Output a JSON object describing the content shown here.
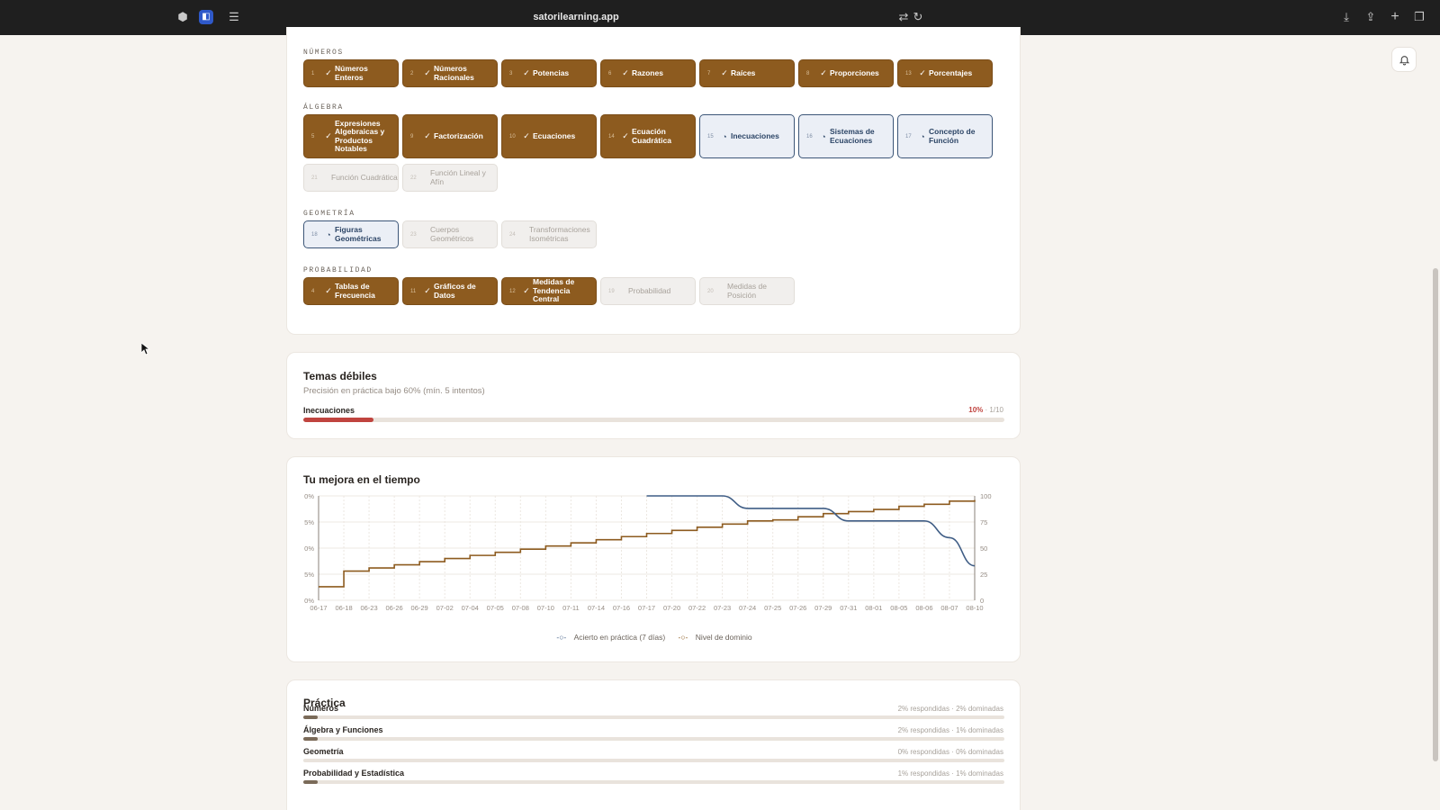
{
  "browser": {
    "url": "satorilearning.app",
    "icons": [
      "sidebar-icon",
      "shield-extension-icon",
      "tab-overview-icon",
      "translate-icon",
      "reload-icon",
      "download-icon",
      "share-icon",
      "new-tab-icon",
      "tabs-icon"
    ]
  },
  "curriculum": {
    "status_legend": {
      "done": "check-icon",
      "in_progress": "progress-clock-icon",
      "locked": "none"
    },
    "sections": [
      {
        "title": "NÚMEROS",
        "chips": [
          {
            "num": "1",
            "label": "Números Enteros",
            "status": "done"
          },
          {
            "num": "2",
            "label": "Números Racionales",
            "status": "done"
          },
          {
            "num": "3",
            "label": "Potencias",
            "status": "done"
          },
          {
            "num": "6",
            "label": "Razones",
            "status": "done"
          },
          {
            "num": "7",
            "label": "Raíces",
            "status": "done"
          },
          {
            "num": "8",
            "label": "Proporciones",
            "status": "done"
          },
          {
            "num": "13",
            "label": "Porcentajes",
            "status": "done"
          }
        ]
      },
      {
        "title": "ÁLGEBRA",
        "chips": [
          {
            "num": "5",
            "label": "Expresiones Algebraicas y Productos Notables",
            "status": "done"
          },
          {
            "num": "9",
            "label": "Factorización",
            "status": "done"
          },
          {
            "num": "10",
            "label": "Ecuaciones",
            "status": "done"
          },
          {
            "num": "14",
            "label": "Ecuación Cuadrática",
            "status": "done"
          },
          {
            "num": "15",
            "label": "Inecuaciones",
            "status": "in_progress"
          },
          {
            "num": "16",
            "label": "Sistemas de Ecuaciones",
            "status": "in_progress"
          },
          {
            "num": "17",
            "label": "Concepto de Función",
            "status": "in_progress"
          },
          {
            "num": "21",
            "label": "Función Cuadrática",
            "status": "locked"
          },
          {
            "num": "22",
            "label": "Función Lineal y Afín",
            "status": "locked"
          }
        ]
      },
      {
        "title": "GEOMETRÍA",
        "chips": [
          {
            "num": "18",
            "label": "Figuras Geométricas",
            "status": "in_progress"
          },
          {
            "num": "23",
            "label": "Cuerpos Geométricos",
            "status": "locked"
          },
          {
            "num": "24",
            "label": "Transformaciones Isométricas",
            "status": "locked"
          }
        ]
      },
      {
        "title": "PROBABILIDAD",
        "chips": [
          {
            "num": "4",
            "label": "Tablas de Frecuencia",
            "status": "done"
          },
          {
            "num": "11",
            "label": "Gráficos de Datos",
            "status": "done"
          },
          {
            "num": "12",
            "label": "Medidas de Tendencia Central",
            "status": "done"
          },
          {
            "num": "19",
            "label": "Probabilidad",
            "status": "locked"
          },
          {
            "num": "20",
            "label": "Medidas de Posición",
            "status": "locked"
          }
        ]
      }
    ]
  },
  "weak_topics": {
    "title": "Temas débiles",
    "subtitle": "Precisión en práctica bajo 60% (mín. 5 intentos)",
    "items": [
      {
        "label": "Inecuaciones",
        "pct_text": "10%",
        "count_text": "· 1/10",
        "fraction": 0.1
      }
    ]
  },
  "improvement": {
    "title": "Tu mejora en el tiempo"
  },
  "chart_data": {
    "type": "line",
    "title": "Tu mejora en el tiempo",
    "x": [
      "06-17",
      "06-18",
      "06-23",
      "06-26",
      "06-29",
      "07-02",
      "07-04",
      "07-05",
      "07-08",
      "07-10",
      "07-11",
      "07-14",
      "07-16",
      "07-17",
      "07-20",
      "07-22",
      "07-23",
      "07-24",
      "07-25",
      "07-26",
      "07-29",
      "07-31",
      "08-01",
      "08-05",
      "08-06",
      "08-07",
      "08-10"
    ],
    "y_left_ticks": [
      "0%",
      "5%",
      "0%",
      "5%",
      "0%"
    ],
    "y_right_ticks": [
      "100",
      "75",
      "50",
      "25",
      "0"
    ],
    "y_right_range": [
      0,
      100
    ],
    "grid": true,
    "legend_position": "bottom-center",
    "series": [
      {
        "name": "Acierto en práctica (7 días)",
        "color": "#3f5d85",
        "axis": "left",
        "values": [
          null,
          null,
          null,
          null,
          null,
          null,
          null,
          null,
          null,
          null,
          null,
          null,
          null,
          100,
          100,
          100,
          100,
          88,
          88,
          88,
          88,
          76,
          76,
          76,
          76,
          60,
          33
        ]
      },
      {
        "name": "Nivel de dominio",
        "color": "#8d5b1f",
        "axis": "right",
        "step": true,
        "values": [
          13,
          28,
          31,
          34,
          37,
          40,
          43,
          46,
          49,
          52,
          55,
          58,
          61,
          64,
          67,
          70,
          73,
          76,
          77,
          80,
          83,
          85,
          87,
          90,
          92,
          95,
          96
        ]
      }
    ]
  },
  "practice": {
    "title": "Práctica",
    "rows": [
      {
        "label": "Números",
        "stat": "2% respondidas · 2% dominadas",
        "answered": 0.02,
        "mastered": 0.02
      },
      {
        "label": "Álgebra y Funciones",
        "stat": "2% respondidas · 1% dominadas",
        "answered": 0.02,
        "mastered": 0.01
      },
      {
        "label": "Geometría",
        "stat": "0% respondidas · 0% dominadas",
        "answered": 0.0,
        "mastered": 0.0
      },
      {
        "label": "Probabilidad y Estadística",
        "stat": "1% respondidas · 1% dominadas",
        "answered": 0.01,
        "mastered": 0.01
      }
    ]
  },
  "colors": {
    "done": "#8d5b1f",
    "in_progress": "#3c5678",
    "weak_bar": "#c0443f",
    "track": "#e9e3dc"
  }
}
